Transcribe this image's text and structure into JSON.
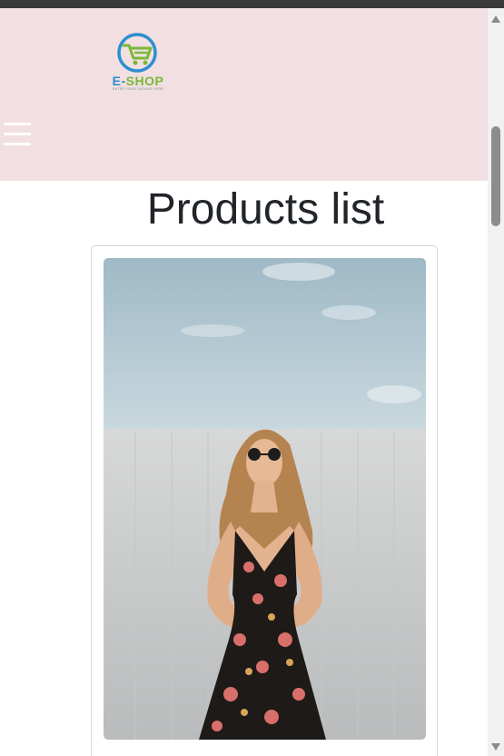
{
  "logo": {
    "brand_e": "E-",
    "brand_shop": "SHOP",
    "tagline": "ENTER YOUR TAGLINE HERE",
    "colors": {
      "blue": "#2b8fd1",
      "green": "#7ab83a"
    },
    "icon": "shopping-cart-icon"
  },
  "header": {
    "background": "#f2dfe1",
    "menu_icon": "hamburger-menu-icon"
  },
  "main": {
    "title": "Products list"
  },
  "product": {
    "image_icon": "product-photo"
  }
}
